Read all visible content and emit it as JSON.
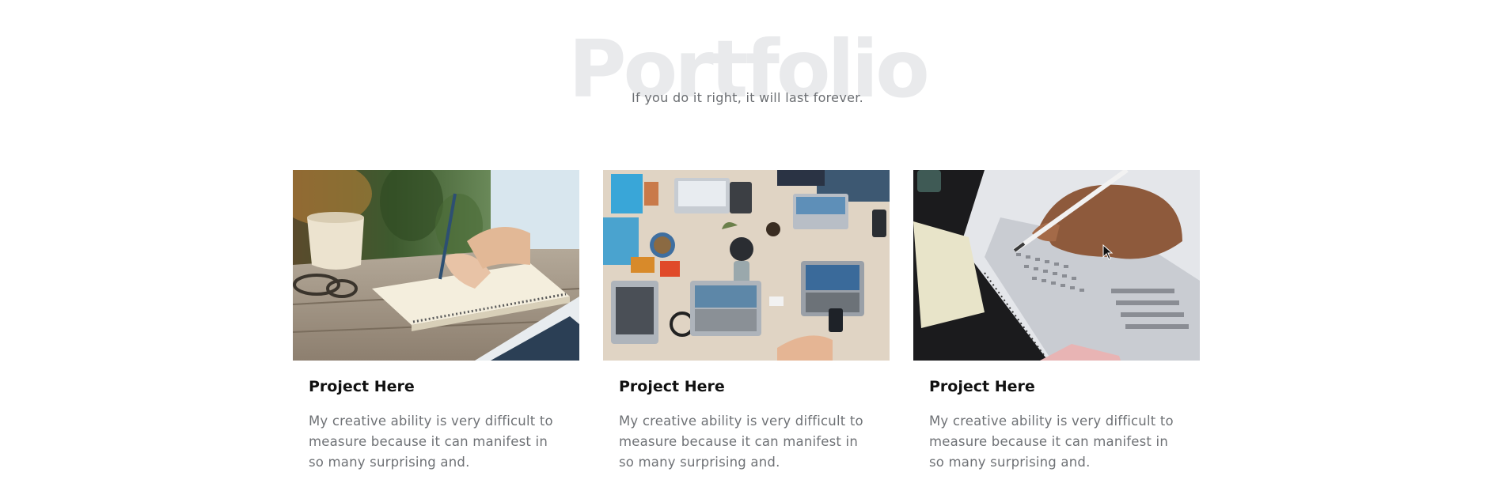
{
  "section": {
    "title": "Portfolio",
    "subtitle": "If you do it right, it will last forever."
  },
  "projects": [
    {
      "title": "Project Here",
      "description": "My creative ability is very difficult to measure because it can manifest in so many surprising and.",
      "image": "writing-notebook-photo"
    },
    {
      "title": "Project Here",
      "description": "My creative ability is very difficult to measure because it can manifest in so many surprising and.",
      "image": "team-laptops-desk-photo"
    },
    {
      "title": "Project Here",
      "description": "My creative ability is very difficult to measure because it can manifest in so many surprising and.",
      "image": "answer-sheet-pencil-photo"
    }
  ],
  "colors": {
    "title_watermark": "#e9eaec",
    "subtitle_text": "#6b6e72",
    "card_title": "#111111",
    "card_text": "#6f7276"
  }
}
